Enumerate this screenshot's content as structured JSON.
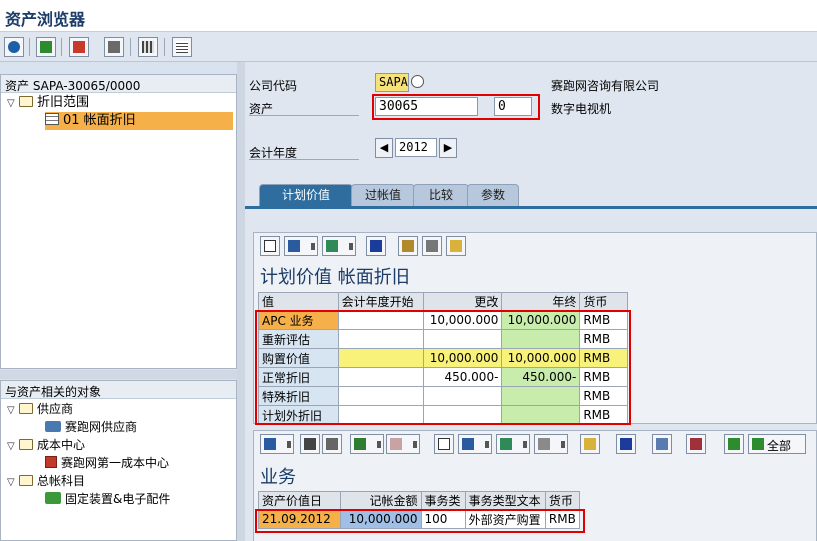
{
  "window": {
    "title": "资产浏览器"
  },
  "toolbar": {
    "icons": [
      "refresh-icon",
      "layout-icon",
      "filter-icon",
      "display-icon",
      "grid-icon",
      "list-icon"
    ]
  },
  "tree": {
    "header": "资产 SAPA-30065/0000",
    "items": [
      {
        "label": "折旧范围"
      },
      {
        "label": "01  帐面折旧"
      }
    ]
  },
  "related": {
    "header": "与资产相关的对象",
    "items": [
      {
        "label": "供应商"
      },
      {
        "label": "赛跑网供应商"
      },
      {
        "label": "成本中心"
      },
      {
        "label": "赛跑网第一成本中心"
      },
      {
        "label": "总帐科目"
      },
      {
        "label": "固定装置&电子配件"
      }
    ]
  },
  "form": {
    "company_code_label": "公司代码",
    "company_code_value": "SAPA",
    "company_name": "赛跑网咨询有限公司",
    "asset_label": "资产",
    "asset_number": "30065",
    "asset_sub": "0",
    "asset_desc": "数字电视机",
    "fiscal_year_label": "会计年度",
    "fiscal_year": "2012"
  },
  "tabs": [
    {
      "label": "计划价值",
      "active": true
    },
    {
      "label": "过帐值"
    },
    {
      "label": "比较"
    },
    {
      "label": "参数"
    }
  ],
  "planned": {
    "title": "计划价值 帐面折旧",
    "columns": [
      "值",
      "会计年度开始",
      "更改",
      "年终",
      "货币"
    ],
    "rows": [
      {
        "name": "APC 业务",
        "start": "",
        "change": "10,000.000",
        "end": "10,000.000",
        "cur": "RMB"
      },
      {
        "name": "重新评估",
        "start": "",
        "change": "",
        "end": "",
        "cur": "RMB"
      },
      {
        "name": "购置价值",
        "start": "",
        "change": "10,000.000",
        "end": "10,000.000",
        "cur": "RMB"
      },
      {
        "name": "正常折旧",
        "start": "",
        "change": "450.000-",
        "end": "450.000-",
        "cur": "RMB"
      },
      {
        "name": "特殊折旧",
        "start": "",
        "change": "",
        "end": "",
        "cur": "RMB"
      },
      {
        "name": "计划外折旧",
        "start": "",
        "change": "",
        "end": "",
        "cur": "RMB"
      }
    ]
  },
  "business": {
    "title": "业务",
    "all_button": "全部",
    "columns": [
      "资产价值日",
      "记帐金额",
      "事务类",
      "事务类型文本",
      "货币"
    ],
    "rows": [
      {
        "date": "21.09.2012",
        "amount": "10,000.000",
        "type": "100",
        "text": "外部资产购置",
        "cur": "RMB"
      }
    ]
  },
  "colors": {
    "accent": "#2f6d9f",
    "selection": "#f5b04a",
    "highlight": "#f9f27a",
    "totals": "#c7ecab",
    "annotation": "#e00000"
  }
}
